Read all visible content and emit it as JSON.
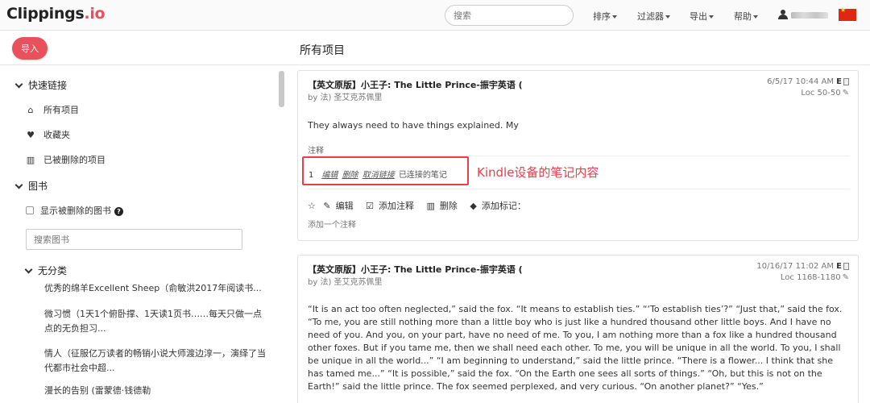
{
  "brand": {
    "name": "Clippings",
    "tld": ".io",
    "accent_color": "#e8505b"
  },
  "search": {
    "placeholder": "搜索"
  },
  "nav": {
    "sort": "排序",
    "filter": "过滤器",
    "export": "导出",
    "help": "帮助"
  },
  "header": {
    "import_label": "导入",
    "page_title": "所有项目"
  },
  "sidebar": {
    "quick_links_title": "快速链接",
    "quick_links": [
      {
        "label": "所有项目",
        "icon": "home-icon"
      },
      {
        "label": "收藏夹",
        "icon": "heart-icon"
      },
      {
        "label": "已被删除的项目",
        "icon": "trash-icon"
      }
    ],
    "books_title": "图书",
    "show_deleted_books": "显示被删除的图书",
    "book_search_placeholder": "搜索图书",
    "uncategorized_title": "无分类",
    "books": [
      "优秀的绵羊Excellent Sheep（俞敏洪2017年阅读书...",
      "微习惯（1天1个俯卧撑、1天读1页书……每天只做一点点的无负担习...",
      "情人（征服亿万读者的畅销小说大师渡边淳一，演绎了当代都市社会中超...",
      "漫长的告别 (雷蒙德·钱德勒"
    ]
  },
  "cards": [
    {
      "title": "【英文原版】小王子: The Little Prince-振宇英语 (",
      "author": "by 法) 圣艾克苏佩里",
      "date": "6/5/17 10:44 AM",
      "badge": "E",
      "loc": "Loc 50-50",
      "text": "They always need to have things explained. My",
      "notes_label": "注释",
      "note": {
        "num": "1",
        "edit": "编辑",
        "delete": "删除",
        "unlink": "取消链接",
        "status": "已连接的笔记"
      },
      "annotation": "Kindle设备的笔记内容",
      "actions": {
        "star": "☆",
        "edit": "编辑",
        "add_note": "添加注释",
        "delete": "删除",
        "add_tag": "添加标记："
      },
      "add_comment": "添加一个注释"
    },
    {
      "title": "【英文原版】小王子: The Little Prince-振宇英语 (",
      "author": "by 法) 圣艾克苏佩里",
      "date": "10/16/17 11:02 AM",
      "badge": "E",
      "loc": "Loc 1168-1180",
      "text": "“It is an act too often neglected,” said the fox. “It means to establish ties.” “‘To establish ties’?” “Just that,” said the fox. “To me, you are still nothing more than a little boy who is just like a hundred thousand other little boys. And I have no need of you. And you, on your part, have no need of me. To you, I am nothing more than a fox like a hundred thousand other foxes. But if you tame me, then we shall need each other. To me, you will be unique in all the world. To you, I shall be unique in all the world...” “I am beginning to understand,” said the little prince. “There is a flower... I think that she has tamed me...” “It is possible,” said the fox. “On the Earth one sees all sorts of things.” “Oh, but this is not on the Earth!” said the little prince. The fox seemed perplexed, and very curious. “On another planet?” “Yes.”"
    }
  ]
}
